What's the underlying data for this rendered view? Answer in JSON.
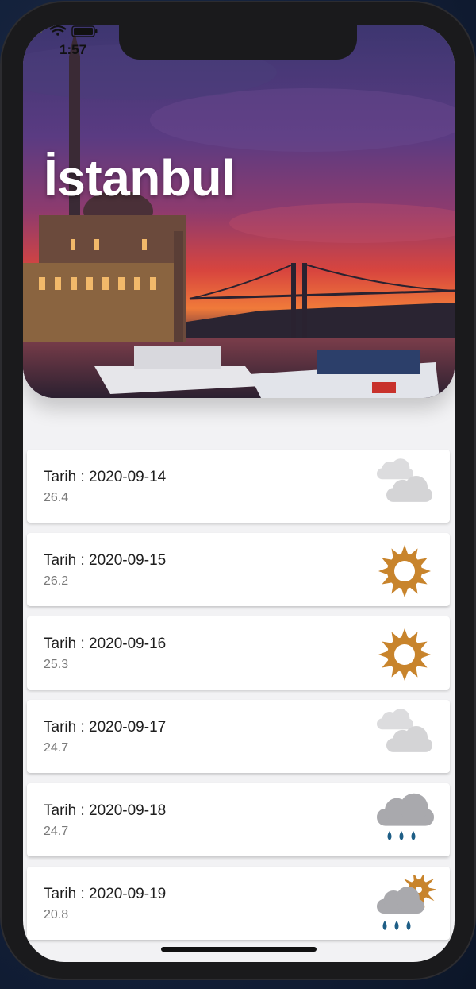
{
  "status_bar": {
    "time": "1:57"
  },
  "header": {
    "city": "İstanbul"
  },
  "forecast": [
    {
      "date": "Tarih : 2020-09-14",
      "temp": "26.4",
      "icon": "cloudy-icon"
    },
    {
      "date": "Tarih : 2020-09-15",
      "temp": "26.2",
      "icon": "sunny-icon"
    },
    {
      "date": "Tarih : 2020-09-16",
      "temp": "25.3",
      "icon": "sunny-icon"
    },
    {
      "date": "Tarih : 2020-09-17",
      "temp": "24.7",
      "icon": "cloudy-icon"
    },
    {
      "date": "Tarih : 2020-09-18",
      "temp": "24.7",
      "icon": "rain-icon"
    },
    {
      "date": "Tarih : 2020-09-19",
      "temp": "20.8",
      "icon": "partly-sunny-rain-icon"
    }
  ],
  "colors": {
    "sun": "#c8842c",
    "cloud": "#d4d4d6",
    "rain_cloud": "#a9a9ad",
    "rain_drop": "#1e5e86"
  }
}
